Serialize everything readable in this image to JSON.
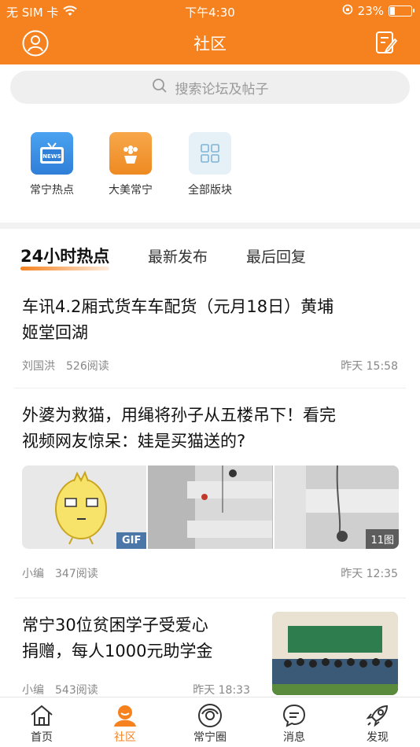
{
  "status_bar": {
    "carrier": "无 SIM 卡",
    "time": "下午4:30",
    "battery": "23%",
    "battery_level": 0.23
  },
  "header": {
    "title": "社区"
  },
  "search": {
    "placeholder": "搜索论坛及帖子"
  },
  "shortcuts": [
    {
      "label": "常宁热点",
      "icon": "tv-news-icon",
      "color": "#3a8ee6"
    },
    {
      "label": "大美常宁",
      "icon": "flower-pot-icon",
      "color": "#f0952a"
    },
    {
      "label": "全部版块",
      "icon": "grid-icon",
      "color": "#e8f2f8"
    }
  ],
  "tabs": [
    {
      "label": "24小时热点",
      "active": true
    },
    {
      "label": "最新发布",
      "active": false
    },
    {
      "label": "最后回复",
      "active": false
    }
  ],
  "posts": [
    {
      "title_line1": "车讯4.2厢式货车车配货（元月18日）黄埔",
      "title_line2": "姬堂回湖",
      "author": "刘国洪",
      "reads": "526阅读",
      "time": "昨天 15:58"
    },
    {
      "title_line1": "外婆为救猫，用绳将孙子从五楼吊下！看完",
      "title_line2": "视频网友惊呆：娃是买猫送的?",
      "author": "小编",
      "reads": "347阅读",
      "time": "昨天 12:35",
      "gif_badge": "GIF",
      "image_count": "11图"
    },
    {
      "title_line1": "常宁30位贫困学子受爱心",
      "title_line2": "捐赠，每人1000元助学金",
      "author": "小编",
      "reads": "543阅读",
      "time": "昨天 18:33"
    }
  ],
  "tabbar": [
    {
      "label": "首页",
      "icon": "home-icon",
      "active": false
    },
    {
      "label": "社区",
      "icon": "community-icon",
      "active": true
    },
    {
      "label": "常宁圈",
      "icon": "circle-icon",
      "active": false
    },
    {
      "label": "消息",
      "icon": "message-icon",
      "active": false
    },
    {
      "label": "发现",
      "icon": "rocket-icon",
      "active": false
    }
  ],
  "colors": {
    "accent": "#f5821f"
  }
}
